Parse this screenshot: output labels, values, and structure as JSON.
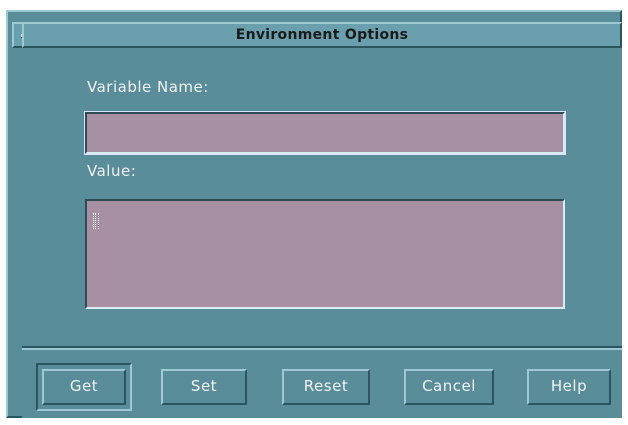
{
  "window": {
    "title": "Environment Options"
  },
  "form": {
    "variable_name_label": "Variable Name:",
    "variable_name_value": "",
    "value_label": "Value:",
    "value_value": ""
  },
  "buttons": {
    "get": "Get",
    "set": "Set",
    "reset": "Reset",
    "cancel": "Cancel",
    "help": "Help"
  },
  "icons": {
    "window_menu": "window-menu-icon",
    "text_cursor": "ibeam-cursor-icon"
  },
  "colors": {
    "background": "#5a8d9a",
    "field": "#a890a4",
    "text": "#f2f2f2"
  }
}
